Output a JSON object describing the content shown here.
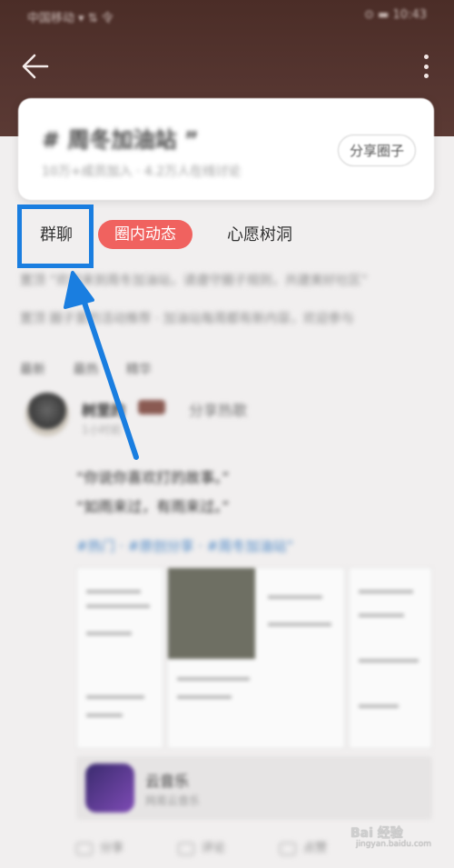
{
  "status_bar": {
    "left": "中国移动 ▾ ⇅ 令",
    "right": "⊙ ▬ 10:43"
  },
  "header": {
    "back_icon": "back-arrow-icon",
    "more_icon": "more-vertical-icon"
  },
  "circle": {
    "title": "# 周冬加油站 ”",
    "subtitle": "10万+成员加入 · 4.2万人在线讨论",
    "share_label": "分享圈子"
  },
  "tabs": [
    {
      "label": "群聊",
      "active": false
    },
    {
      "label": "圈内动态",
      "active": true
    },
    {
      "label": "心愿树洞",
      "active": false
    }
  ],
  "notices": [
    "置顶  “欢迎来到周冬加油站，请遵守圈子规则，共建美好社区”",
    "置顶  圈子里的活动推荐 · 加油站每周都有新内容，欢迎参与"
  ],
  "sort_tabs": [
    "最新",
    "最热",
    "精华"
  ],
  "post": {
    "author": "树里的",
    "action": "分享热歌",
    "time": "1小时前",
    "lines": [
      "“你说你喜欢打的故事。”",
      "“如雨来过，有雨来过。”"
    ],
    "tags": "#热门 · #原创分享 · #周冬加油站”",
    "app_name": "云音乐",
    "app_meta": "网易云音乐"
  },
  "actions": [
    "分享",
    "评论",
    "点赞"
  ],
  "watermark": {
    "text": "Bai 经验",
    "sub": "jingyan.baidu.com"
  },
  "colors": {
    "accent": "#f0625f",
    "highlight": "#1a7ee0",
    "header": "#4b2d27"
  }
}
